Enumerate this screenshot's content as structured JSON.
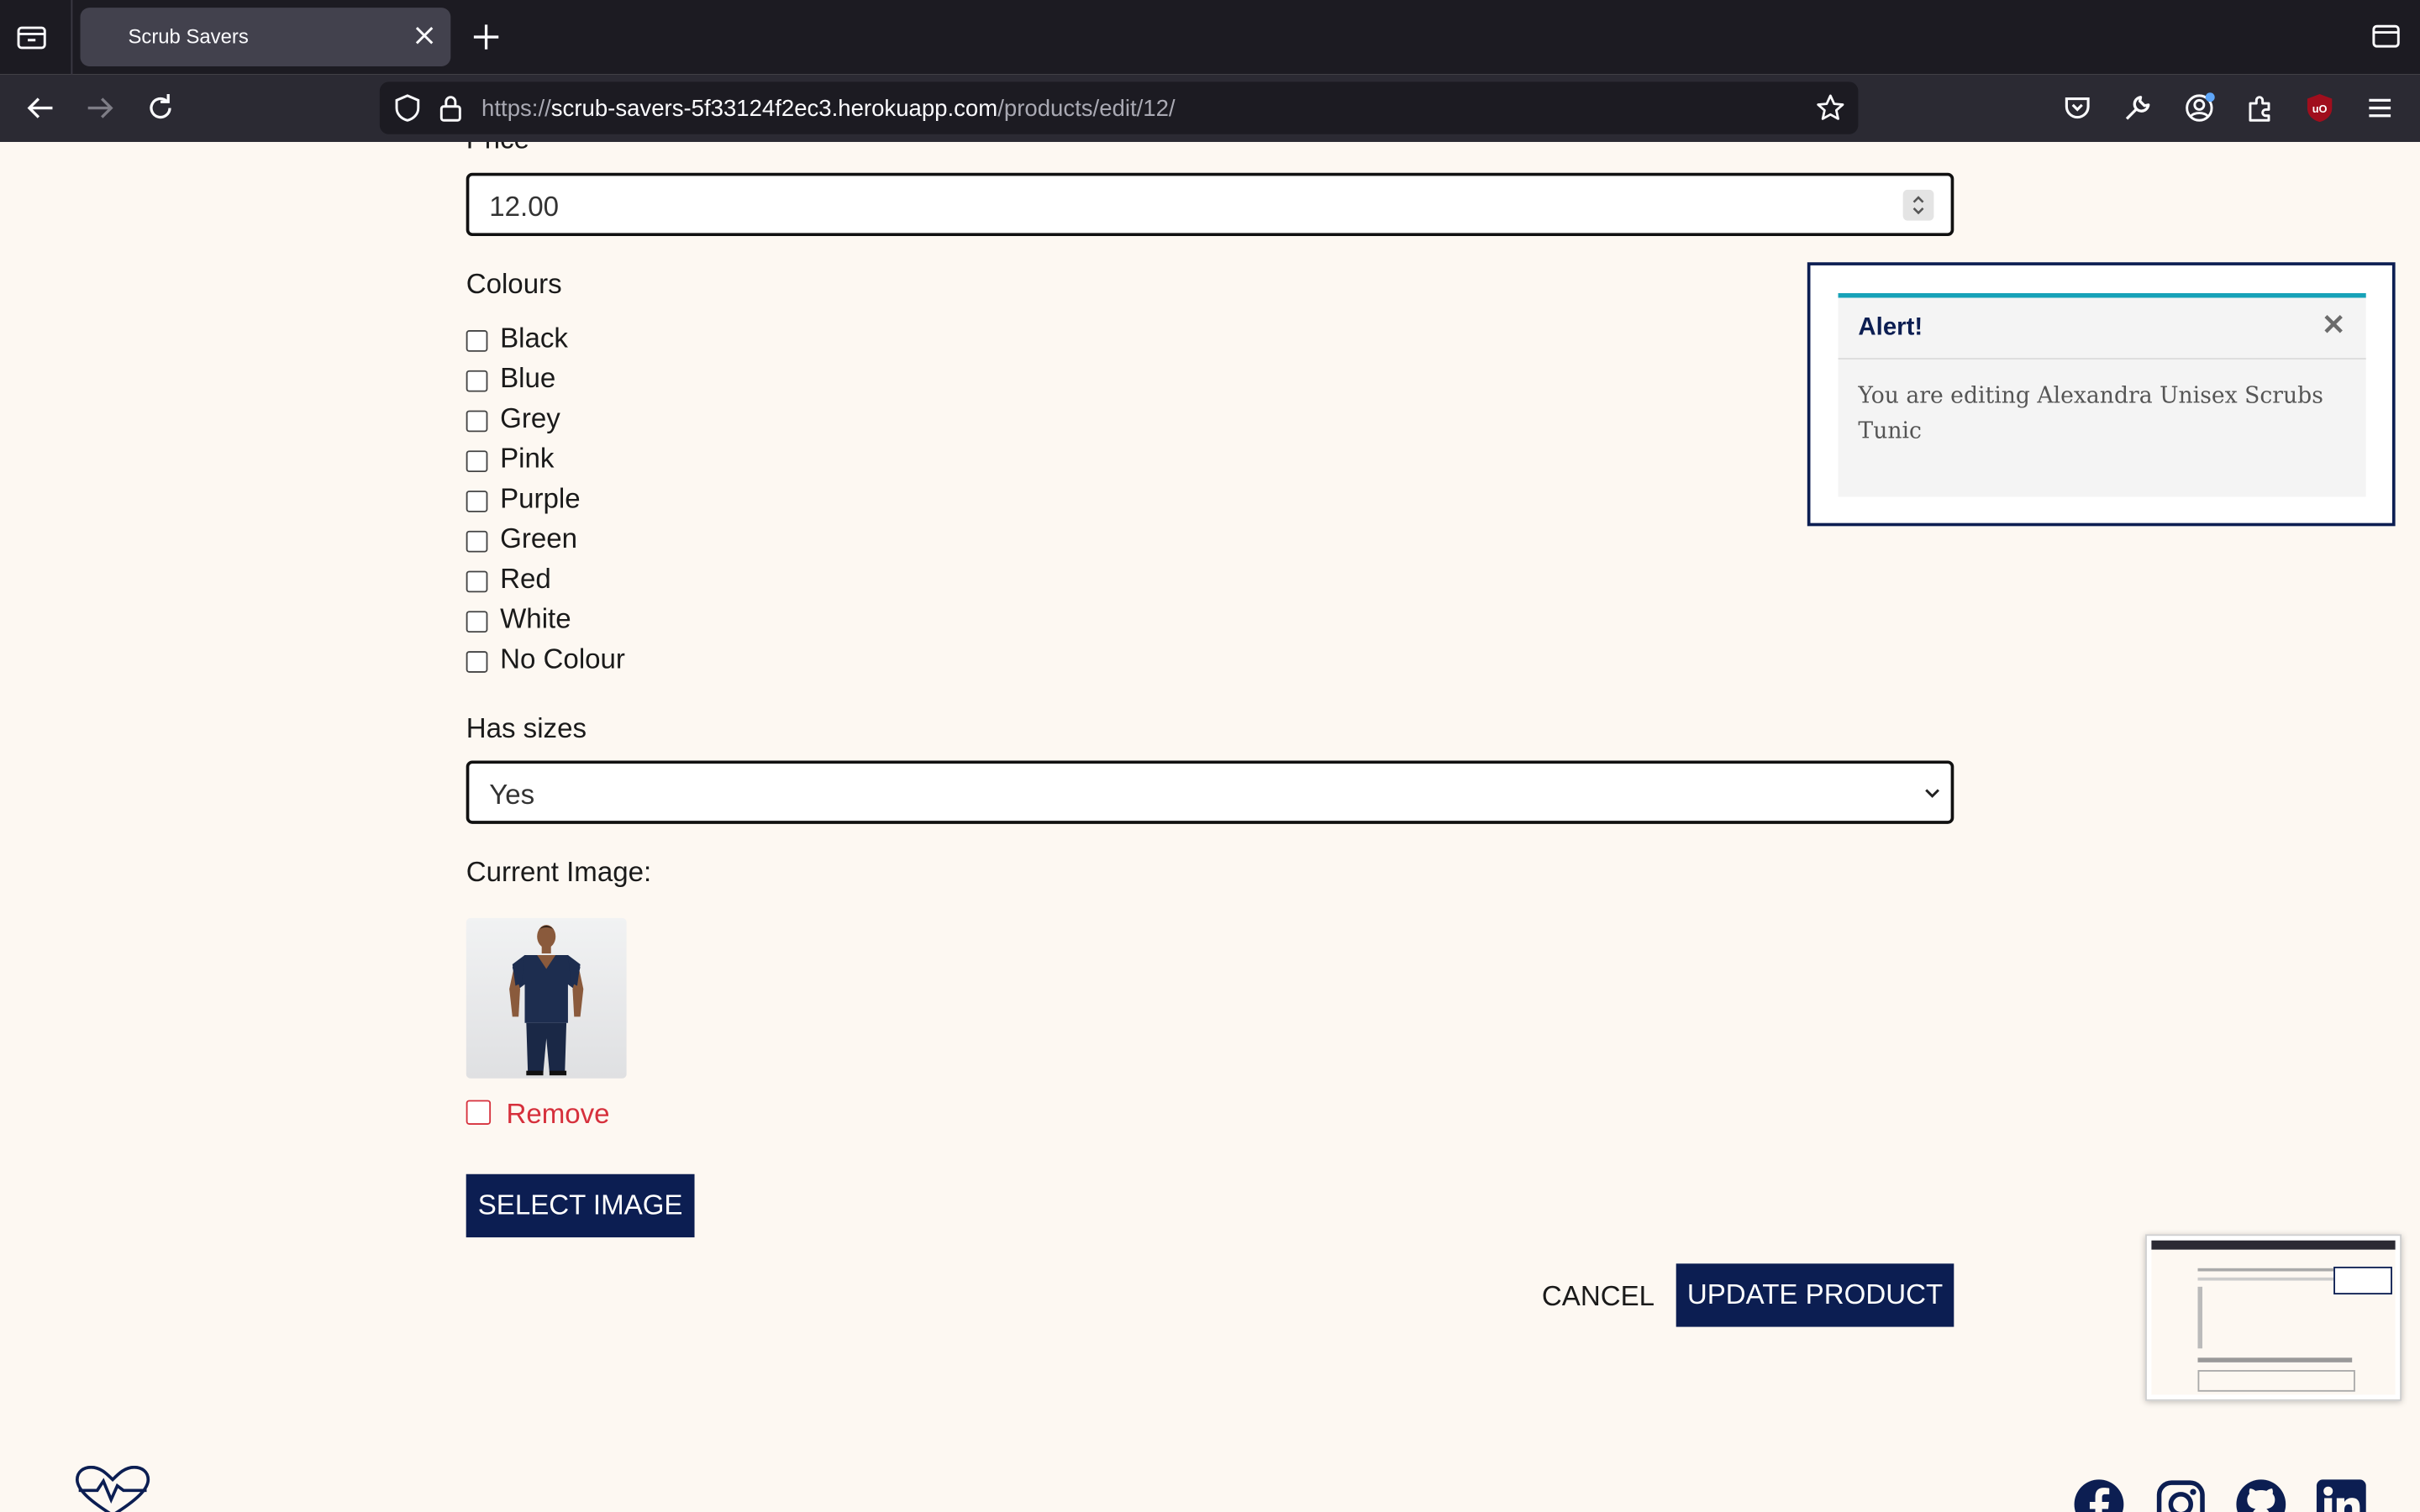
{
  "browser": {
    "tab_title": "Scrub Savers",
    "url_prefix": "https://",
    "url_host": "scrub-savers-5f33124f2ec3.herokuapp.com",
    "url_path": "/products/edit/12/"
  },
  "form": {
    "price_label": "Price",
    "price_value": "12.00",
    "colours_label": "Colours",
    "colours": [
      "Black",
      "Blue",
      "Grey",
      "Pink",
      "Purple",
      "Green",
      "Red",
      "White",
      "No Colour"
    ],
    "has_sizes_label": "Has sizes",
    "has_sizes_value": "Yes",
    "current_image_label": "Current Image:",
    "remove_label": "Remove",
    "select_image_label": "SELECT IMAGE",
    "cancel_label": "CANCEL",
    "update_label": "UPDATE PRODUCT"
  },
  "alert": {
    "title": "Alert!",
    "message": "You are editing Alexandra Unisex Scrubs Tunic"
  },
  "footer": {
    "social_icons": [
      "facebook-icon",
      "instagram-icon",
      "github-icon",
      "linkedin-icon"
    ]
  },
  "colors": {
    "navy": "#0c1e52",
    "page_background": "#fdf8f2",
    "alert_accent": "#17a2b8",
    "remove_red": "#d6303c"
  }
}
